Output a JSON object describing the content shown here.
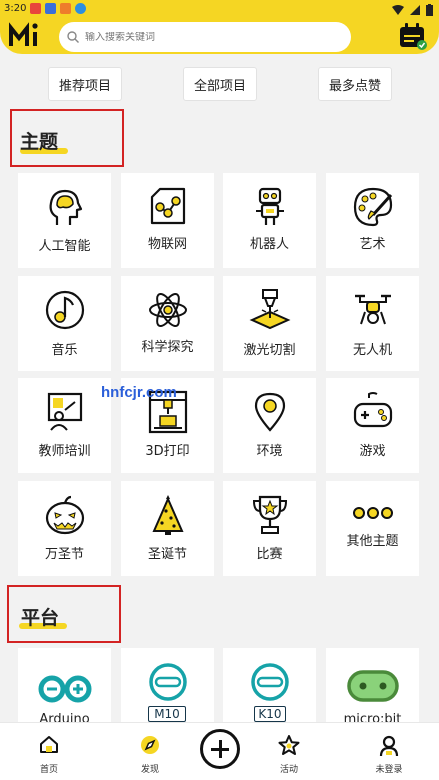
{
  "status_bar": {
    "time": "3:20"
  },
  "search": {
    "placeholder": "输入搜索关键词"
  },
  "filters": [
    "推荐项目",
    "全部项目",
    "最多点赞"
  ],
  "sections": {
    "topics": {
      "title": "主题"
    },
    "platforms": {
      "title": "平台"
    }
  },
  "topics": [
    {
      "label": "人工智能",
      "icon": "ai-head-icon"
    },
    {
      "label": "物联网",
      "icon": "iot-icon"
    },
    {
      "label": "机器人",
      "icon": "robot-icon"
    },
    {
      "label": "艺术",
      "icon": "palette-icon"
    },
    {
      "label": "音乐",
      "icon": "music-icon"
    },
    {
      "label": "科学探究",
      "icon": "atom-icon"
    },
    {
      "label": "激光切割",
      "icon": "laser-icon"
    },
    {
      "label": "无人机",
      "icon": "drone-icon"
    },
    {
      "label": "教师培训",
      "icon": "teacher-icon"
    },
    {
      "label": "3D打印",
      "icon": "printer-3d-icon"
    },
    {
      "label": "环境",
      "icon": "location-pin-icon"
    },
    {
      "label": "游戏",
      "icon": "gamepad-icon"
    },
    {
      "label": "万圣节",
      "icon": "pumpkin-icon"
    },
    {
      "label": "圣诞节",
      "icon": "christmas-tree-icon"
    },
    {
      "label": "比赛",
      "icon": "trophy-icon"
    },
    {
      "label": "其他主题",
      "icon": "more-dots-icon"
    }
  ],
  "platforms": [
    {
      "label": "Arduino",
      "icon": "arduino-icon"
    },
    {
      "label": "M10",
      "icon": "m10-icon"
    },
    {
      "label": "K10",
      "icon": "k10-icon"
    },
    {
      "label": "micro:bit",
      "icon": "microbit-icon"
    }
  ],
  "watermark": "hnfcjr.com",
  "nav": [
    {
      "label": "首页",
      "icon": "home-icon"
    },
    {
      "label": "发现",
      "icon": "compass-icon"
    },
    {
      "label": "活动",
      "icon": "star-icon"
    },
    {
      "label": "未登录",
      "icon": "user-icon"
    }
  ],
  "colors": {
    "accent": "#f5d623",
    "highlight_box": "#d32323",
    "watermark": "#2b5fd9"
  }
}
